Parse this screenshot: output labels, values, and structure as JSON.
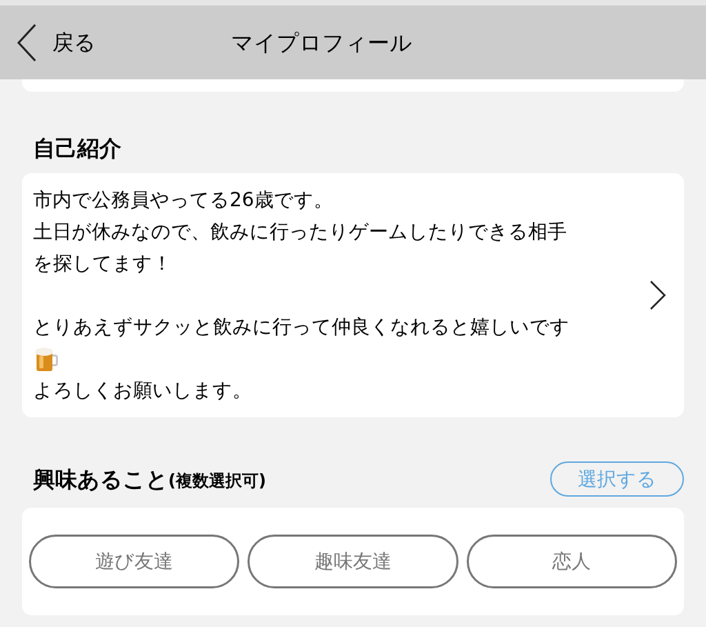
{
  "header": {
    "back_label": "戻る",
    "title": "マイプロフィール"
  },
  "bio": {
    "heading": "自己紹介",
    "lines": [
      {
        "kind": "text",
        "text": "市内で公務員やってる26歳です。"
      },
      {
        "kind": "text",
        "text": "土日が休みなので、飲みに行ったりゲームしたりできる相手"
      },
      {
        "kind": "text",
        "text": "を探してます！"
      },
      {
        "kind": "blank"
      },
      {
        "kind": "text",
        "text": "とりあえずサクッと飲みに行って仲良くなれると嬉しいです"
      },
      {
        "kind": "icon"
      },
      {
        "kind": "text",
        "text": "よろしくお願いします。"
      }
    ]
  },
  "interests": {
    "heading": "興味あること",
    "note": "(複数選択可)",
    "select_button": "選択する",
    "chips": [
      {
        "label": "遊び友達",
        "selected": false
      },
      {
        "label": "趣味友達",
        "selected": false
      },
      {
        "label": "恋人",
        "selected": false
      }
    ]
  }
}
